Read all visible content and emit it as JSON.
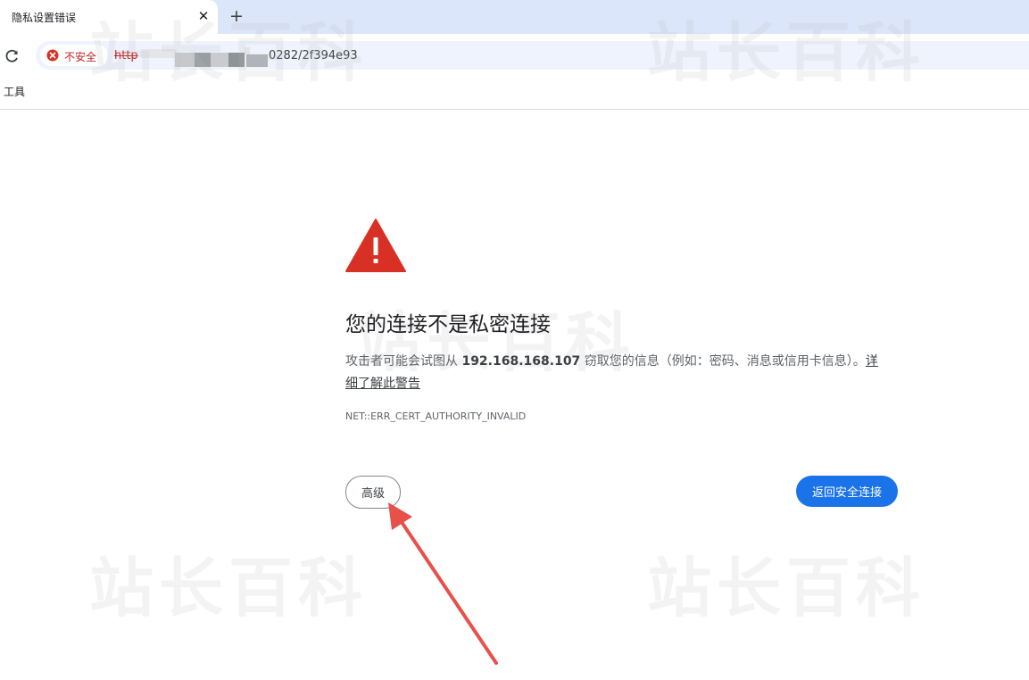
{
  "tab": {
    "title": "隐私设置错误",
    "close_glyph": "✕",
    "new_tab_glyph": "+"
  },
  "omnibox": {
    "security_chip": "不安全",
    "url_scheme": "http",
    "url_tail": "0282/2f394e93"
  },
  "bookmarks": [
    {
      "label": "工具"
    }
  ],
  "watermark": {
    "text": "站长百科"
  },
  "interstitial": {
    "heading": "您的连接不是私密连接",
    "desc_prefix": "攻击者可能会试图从 ",
    "host": "192.168.168.107",
    "desc_suffix": " 窃取您的信息（例如：密码、消息或信用卡信息）。",
    "learn_more": "详细了解此警告",
    "error_code": "NET::ERR_CERT_AUTHORITY_INVALID",
    "advanced_button": "高级",
    "back_button": "返回安全连接"
  },
  "colors": {
    "danger": "#d93025",
    "primary": "#1a73e8",
    "tabstrip": "#dbe6fb",
    "annotation_arrow": "#e8504a"
  }
}
